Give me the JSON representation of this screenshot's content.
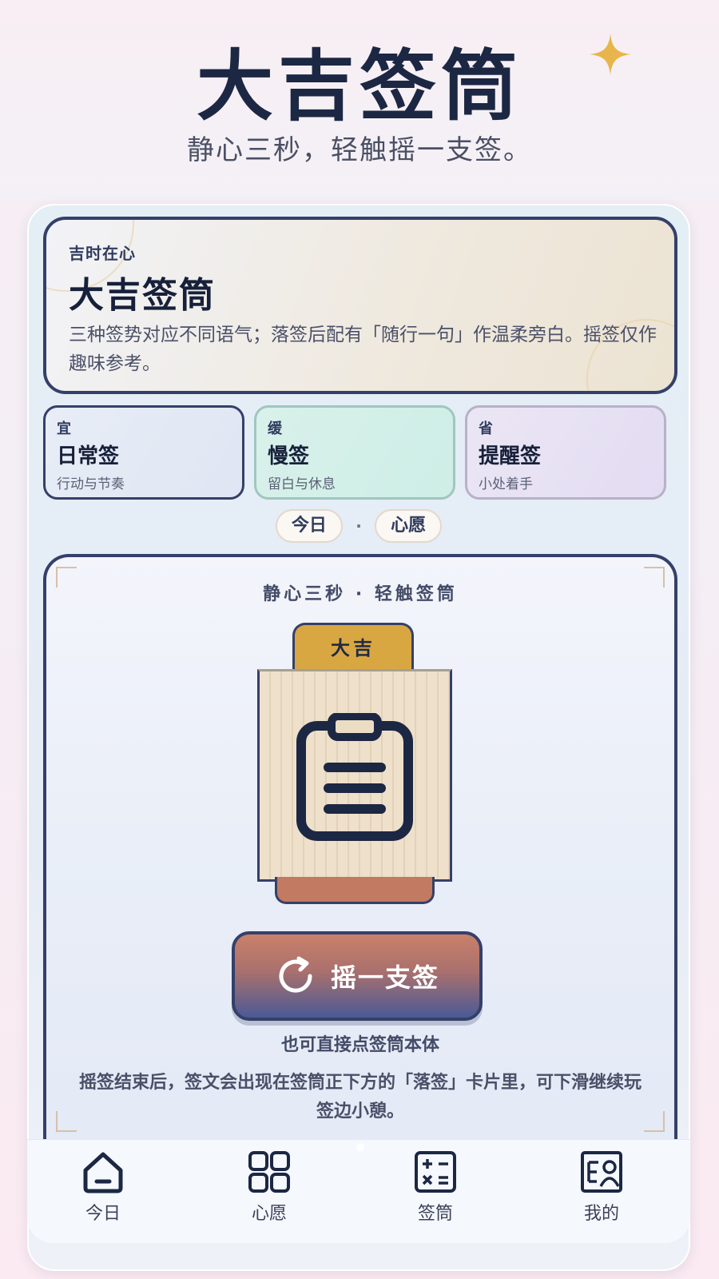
{
  "header": {
    "title": "大吉签筒",
    "subtitle": "静心三秒，轻触摇一支签。"
  },
  "intro": {
    "eyebrow": "吉时在心",
    "title": "大吉签筒",
    "description": "三种签势对应不同语气；落签后配有「随行一句」作温柔旁白。摇签仅作趣味参考。"
  },
  "fortune_types": [
    {
      "tag": "宜",
      "name": "日常签",
      "desc": "行动与节奏"
    },
    {
      "tag": "缓",
      "name": "慢签",
      "desc": "留白与休息"
    },
    {
      "tag": "省",
      "name": "提醒签",
      "desc": "小处着手"
    }
  ],
  "chips": {
    "today": "今日",
    "separator": "·",
    "wish": "心愿"
  },
  "shake": {
    "hint": "静心三秒 · 轻触签筒",
    "tube_label": "大吉",
    "button_label": "摇一支签",
    "tap_hint": "也可直接点签筒本体",
    "result_hint": "摇签结束后，签文会出现在签筒正下方的「落签」卡片里，可下滑继续玩签边小憩。"
  },
  "nav": {
    "items": [
      {
        "label": "今日",
        "icon": "home-icon"
      },
      {
        "label": "心愿",
        "icon": "grid-icon"
      },
      {
        "label": "签筒",
        "icon": "calculator-icon"
      },
      {
        "label": "我的",
        "icon": "profile-card-icon"
      }
    ]
  },
  "colors": {
    "navy": "#34406a",
    "gold": "#d9a742",
    "terracotta": "#c9816a",
    "indigo": "#4a5a96"
  }
}
